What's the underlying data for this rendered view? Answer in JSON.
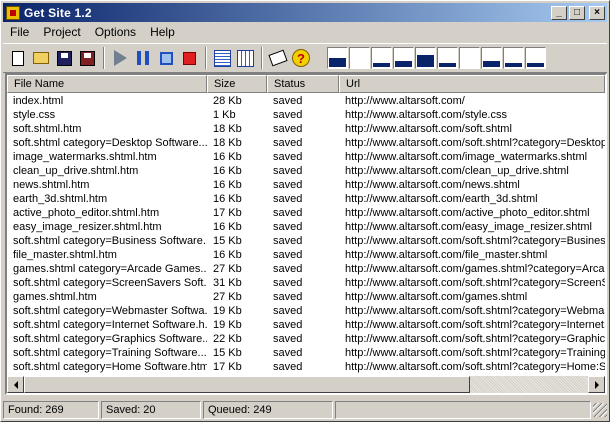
{
  "window": {
    "title": "Get Site 1.2"
  },
  "titlebar_buttons": {
    "minimize": "_",
    "maximize": "□",
    "close": "×"
  },
  "menu": [
    "File",
    "Project",
    "Options",
    "Help"
  ],
  "toolbar": {
    "icons": [
      "new-file-icon",
      "open-folder-icon",
      "save-icon",
      "save-as-icon",
      "play-icon",
      "pause-icon",
      "stop-icon",
      "abort-icon",
      "list-view-icon",
      "detail-view-icon",
      "book-icon",
      "help-icon"
    ],
    "help_glyph": "?"
  },
  "threads": [
    0.45,
    0,
    0.2,
    0.3,
    0.6,
    0.2,
    0,
    0.3,
    0.2,
    0.2
  ],
  "columns": [
    "File Name",
    "Size",
    "Status",
    "Url"
  ],
  "rows": [
    [
      "index.html",
      "28 Kb",
      "saved",
      "http://www.altarsoft.com/"
    ],
    [
      "style.css",
      "1 Kb",
      "saved",
      "http://www.altarsoft.com/style.css"
    ],
    [
      "soft.shtml.htm",
      "18 Kb",
      "saved",
      "http://www.altarsoft.com/soft.shtml"
    ],
    [
      "soft.shtml category=Desktop Software....",
      "18 Kb",
      "saved",
      "http://www.altarsoft.com/soft.shtml?category=Desktop"
    ],
    [
      "image_watermarks.shtml.htm",
      "16 Kb",
      "saved",
      "http://www.altarsoft.com/image_watermarks.shtml"
    ],
    [
      "clean_up_drive.shtml.htm",
      "16 Kb",
      "saved",
      "http://www.altarsoft.com/clean_up_drive.shtml"
    ],
    [
      "news.shtml.htm",
      "16 Kb",
      "saved",
      "http://www.altarsoft.com/news.shtml"
    ],
    [
      "earth_3d.shtml.htm",
      "16 Kb",
      "saved",
      "http://www.altarsoft.com/earth_3d.shtml"
    ],
    [
      "active_photo_editor.shtml.htm",
      "17 Kb",
      "saved",
      "http://www.altarsoft.com/active_photo_editor.shtml"
    ],
    [
      "easy_image_resizer.shtml.htm",
      "16 Kb",
      "saved",
      "http://www.altarsoft.com/easy_image_resizer.shtml"
    ],
    [
      "soft.shtml category=Business Software....",
      "15 Kb",
      "saved",
      "http://www.altarsoft.com/soft.shtml?category=Business"
    ],
    [
      "file_master.shtml.htm",
      "16 Kb",
      "saved",
      "http://www.altarsoft.com/file_master.shtml"
    ],
    [
      "games.shtml category=Arcade Games....",
      "27 Kb",
      "saved",
      "http://www.altarsoft.com/games.shtml?category=Arcad"
    ],
    [
      "soft.shtml category=ScreenSavers Soft...",
      "31 Kb",
      "saved",
      "http://www.altarsoft.com/soft.shtml?category=ScreenS"
    ],
    [
      "games.shtml.htm",
      "27 Kb",
      "saved",
      "http://www.altarsoft.com/games.shtml"
    ],
    [
      "soft.shtml category=Webmaster Softwa...",
      "19 Kb",
      "saved",
      "http://www.altarsoft.com/soft.shtml?category=Webmas"
    ],
    [
      "soft.shtml category=Internet Software.h...",
      "19 Kb",
      "saved",
      "http://www.altarsoft.com/soft.shtml?category=Internet:S"
    ],
    [
      "soft.shtml category=Graphics Software....",
      "22 Kb",
      "saved",
      "http://www.altarsoft.com/soft.shtml?category=Graphics"
    ],
    [
      "soft.shtml category=Training Software....",
      "15 Kb",
      "saved",
      "http://www.altarsoft.com/soft.shtml?category=Training:"
    ],
    [
      "soft.shtml category=Home Software.htm",
      "17 Kb",
      "saved",
      "http://www.altarsoft.com/soft.shtml?category=Home:Sc"
    ]
  ],
  "status": {
    "found": "Found: 269",
    "saved": "Saved: 20",
    "queued": "Queued: 249",
    "extra": ""
  },
  "colors": {
    "titlebar_start": "#0a246a",
    "titlebar_end": "#a6caf0",
    "face": "#d4d0c8",
    "thread_fill": "#0a246a"
  }
}
